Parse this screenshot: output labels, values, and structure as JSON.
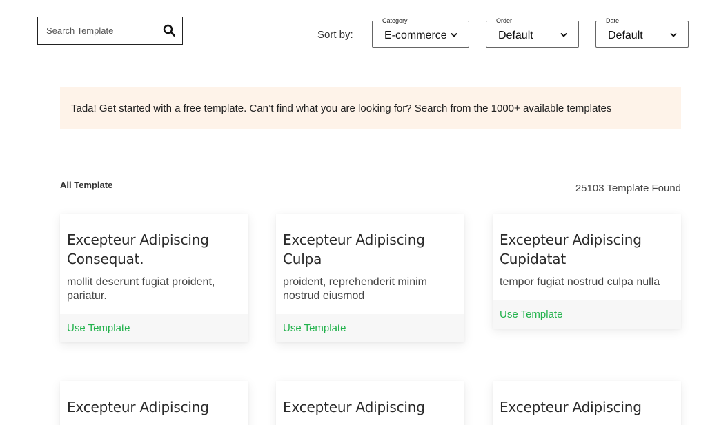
{
  "search": {
    "placeholder": "Search Template",
    "icon": "search-icon"
  },
  "sort": {
    "label": "Sort by:",
    "category": {
      "legend": "Category",
      "value": "E-commerce"
    },
    "order": {
      "legend": "Order",
      "value": "Default"
    },
    "date": {
      "legend": "Date",
      "value": "Default"
    }
  },
  "banner": {
    "text": "Tada! Get started with a free template. Can’t find what you are looking for? Search from the 1000+ available templates"
  },
  "section": {
    "title": "All Template",
    "count": "25103 Template Found"
  },
  "cards": [
    {
      "title": "Excepteur Adipiscing Consequat.",
      "desc": "mollit deserunt fugiat proident, pariatur.",
      "action": "Use Template"
    },
    {
      "title": "Excepteur Adipiscing Culpa",
      "desc": "proident, reprehenderit minim nostrud eiusmod",
      "action": "Use Template"
    },
    {
      "title": "Excepteur Adipiscing Cupidatat",
      "desc": "tempor fugiat nostrud culpa nulla",
      "action": "Use Template"
    },
    {
      "title": "Excepteur Adipiscing"
    },
    {
      "title": "Excepteur Adipiscing"
    },
    {
      "title": "Excepteur Adipiscing"
    }
  ],
  "colors": {
    "accent": "#22b24c",
    "banner_bg": "#fef3e9"
  }
}
